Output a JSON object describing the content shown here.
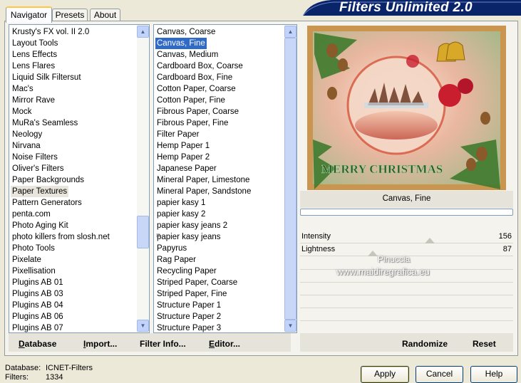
{
  "title": "Filters Unlimited 2.0",
  "tabs": [
    {
      "label": "Navigator"
    },
    {
      "label": "Presets"
    },
    {
      "label": "About"
    }
  ],
  "categories": {
    "items": [
      "Krusty's FX vol. II 2.0",
      "Layout Tools",
      "Lens Effects",
      "Lens Flares",
      "Liquid Silk Filtersut",
      "Mac's",
      "Mirror Rave",
      "Mock",
      "MuRa's Seamless",
      "Neology",
      "Nirvana",
      "Noise Filters",
      "Oliver's Filters",
      "Paper Backgrounds",
      "Paper Textures",
      "Pattern Generators",
      "penta.com",
      "Photo Aging Kit",
      "photo killers from slosh.net",
      "Photo Tools",
      "Pixelate",
      "Pixellisation",
      "Plugins AB 01",
      "Plugins AB 03",
      "Plugins AB 04",
      "Plugins AB 06",
      "Plugins AB 07"
    ],
    "selected": "Paper Textures"
  },
  "filters": {
    "items": [
      "Canvas, Coarse",
      "Canvas, Fine",
      "Canvas, Medium",
      "Cardboard Box, Coarse",
      "Cardboard Box, Fine",
      "Cotton Paper, Coarse",
      "Cotton Paper, Fine",
      "Fibrous Paper, Coarse",
      "Fibrous Paper, Fine",
      "Filter Paper",
      "Hemp Paper 1",
      "Hemp Paper 2",
      "Japanese Paper",
      "Mineral Paper, Limestone",
      "Mineral Paper, Sandstone",
      "papier kasy 1",
      "papier kasy 2",
      "papier kasy jeans 2",
      "papier kasy jeans",
      "Papyrus",
      "Rag Paper",
      "Recycling Paper",
      "Striped Paper, Coarse",
      "Striped Paper, Fine",
      "Structure Paper 1",
      "Structure Paper 2",
      "Structure Paper 3"
    ],
    "selected": "Canvas, Fine"
  },
  "preview": {
    "text": "MERRY CHRISTMAS",
    "filter_name": "Canvas, Fine",
    "progress": 0
  },
  "params": [
    {
      "label": "Intensity",
      "value": "156"
    },
    {
      "label": "Lightness",
      "value": "87"
    }
  ],
  "watermark": {
    "line1": "Pinuccia",
    "line2": "www.maidiregrafica.eu"
  },
  "toolbar": {
    "database": "Database",
    "import": "Import...",
    "filter_info": "Filter Info...",
    "editor": "Editor...",
    "randomize": "Randomize",
    "reset": "Reset"
  },
  "status": {
    "database_label": "Database:",
    "database_value": "ICNET-Filters",
    "filters_label": "Filters:",
    "filters_value": "1334"
  },
  "buttons": {
    "apply": "Apply",
    "cancel": "Cancel",
    "help": "Help"
  },
  "colors": {
    "banner": "#0a246a",
    "selection": "#316ac5",
    "preview_frame": "#c9954f"
  }
}
